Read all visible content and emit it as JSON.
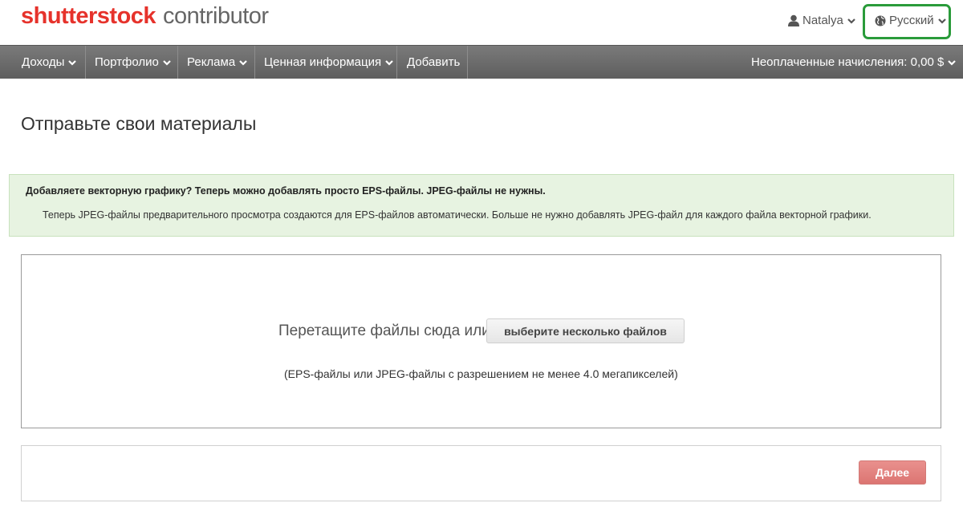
{
  "header": {
    "logo_brand": "shutterstock",
    "logo_sub": "contributor",
    "user_name": "Natalya",
    "language": "Русский"
  },
  "nav": {
    "items": [
      {
        "label": "Доходы",
        "has_dropdown": true
      },
      {
        "label": "Портфолио",
        "has_dropdown": true
      },
      {
        "label": "Реклама",
        "has_dropdown": true
      },
      {
        "label": "Ценная информация",
        "has_dropdown": true
      },
      {
        "label": "Добавить",
        "has_dropdown": false
      }
    ],
    "unpaid_label": "Неоплаченные начисления: 0,00 $"
  },
  "page": {
    "title": "Отправьте свои материалы"
  },
  "alert": {
    "heading": "Добавляете векторную графику? Теперь можно добавлять просто EPS-файлы. JPEG-файлы не нужны.",
    "body": "Теперь JPEG-файлы предварительного просмотра создаются для EPS-файлов автоматически. Больше не нужно добавлять JPEG-файл для каждого файла векторной графики."
  },
  "upload": {
    "drop_text": "Перетащите файлы сюда или",
    "select_button": "выберите несколько файлов",
    "hint": "(EPS-файлы или JPEG-файлы с разрешением не менее 4.0 мегапикселей)"
  },
  "footer": {
    "next_button": "Далее"
  },
  "colors": {
    "brand_red": "#e6322b",
    "nav_bg": "#666666",
    "alert_bg": "#e7f3e1",
    "highlight_green": "#2a9b3a",
    "next_button": "#de7b78"
  }
}
